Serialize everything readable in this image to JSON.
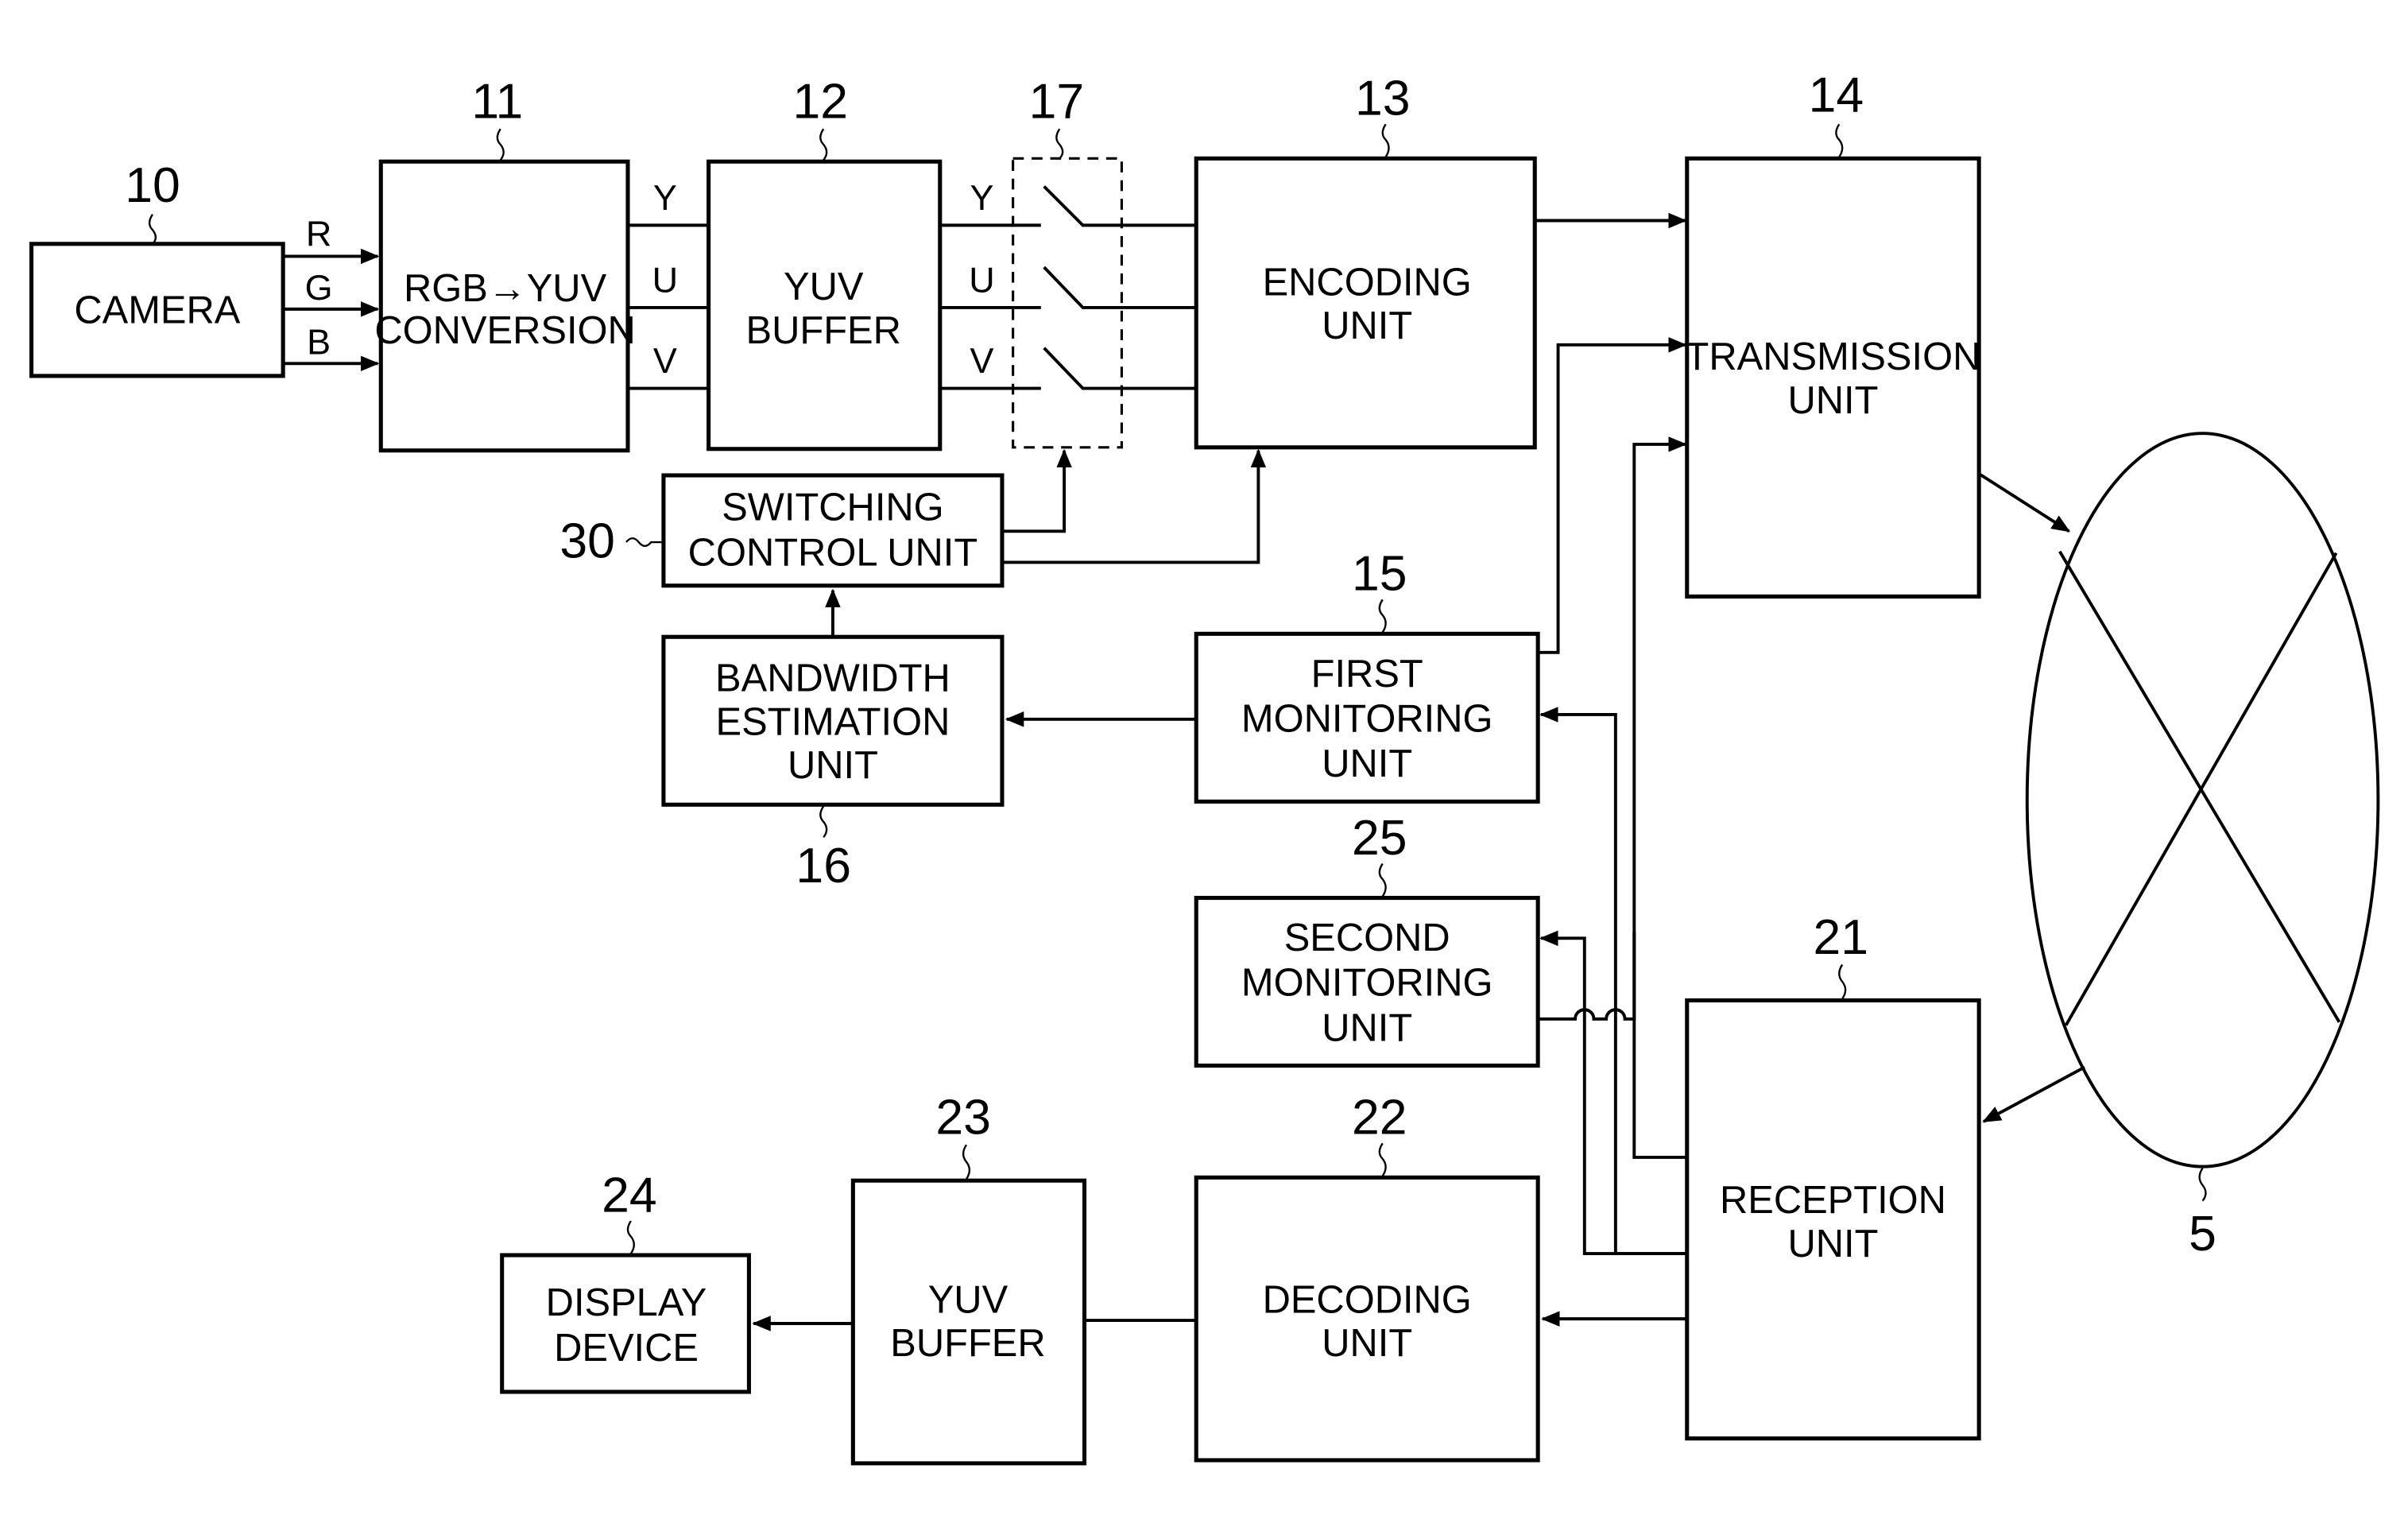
{
  "diagram": {
    "blocks": [
      {
        "id": "camera",
        "ref": "10",
        "lines": [
          "CAMERA"
        ]
      },
      {
        "id": "rgb-yuv-conversion",
        "ref": "11",
        "lines": [
          "RGB→YUV",
          "CONVERSION"
        ]
      },
      {
        "id": "yuv-buffer-tx",
        "ref": "12",
        "lines": [
          "YUV",
          "BUFFER"
        ]
      },
      {
        "id": "encoding-unit",
        "ref": "13",
        "lines": [
          "ENCODING",
          "UNIT"
        ]
      },
      {
        "id": "transmission-unit",
        "ref": "14",
        "lines": [
          "TRANSMISSION",
          "UNIT"
        ]
      },
      {
        "id": "first-monitoring-unit",
        "ref": "15",
        "lines": [
          "FIRST",
          "MONITORING",
          "UNIT"
        ]
      },
      {
        "id": "bandwidth-estimation-unit",
        "ref": "16",
        "lines": [
          "BANDWIDTH",
          "ESTIMATION",
          "UNIT"
        ]
      },
      {
        "id": "switch-group",
        "ref": "17",
        "lines": []
      },
      {
        "id": "reception-unit",
        "ref": "21",
        "lines": [
          "RECEPTION",
          "UNIT"
        ]
      },
      {
        "id": "decoding-unit",
        "ref": "22",
        "lines": [
          "DECODING",
          "UNIT"
        ]
      },
      {
        "id": "yuv-buffer-rx",
        "ref": "23",
        "lines": [
          "YUV",
          "BUFFER"
        ]
      },
      {
        "id": "display-device",
        "ref": "24",
        "lines": [
          "DISPLAY",
          "DEVICE"
        ]
      },
      {
        "id": "second-monitoring-unit",
        "ref": "25",
        "lines": [
          "SECOND",
          "MONITORING",
          "UNIT"
        ]
      },
      {
        "id": "switching-control-unit",
        "ref": "30",
        "lines": [
          "SWITCHING",
          "CONTROL UNIT"
        ]
      },
      {
        "id": "network",
        "ref": "5",
        "lines": []
      }
    ],
    "signals": {
      "camera_out": [
        "R",
        "G",
        "B"
      ],
      "conversion_out": [
        "Y",
        "U",
        "V"
      ],
      "buffer_out": [
        "Y",
        "U",
        "V"
      ]
    }
  }
}
